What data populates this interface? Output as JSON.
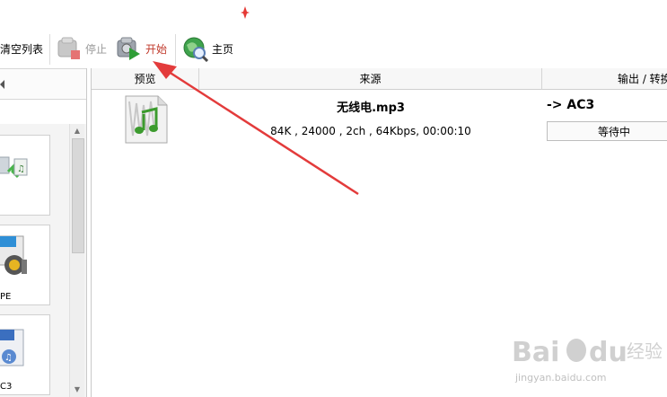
{
  "toolbar": {
    "clear_label": "清空列表",
    "stop_label": "停止",
    "start_label": "开始",
    "home_label": "主页"
  },
  "sidebar": {
    "cards": [
      {
        "label": ""
      },
      {
        "label": "PE"
      },
      {
        "label": "C3"
      }
    ]
  },
  "table": {
    "columns": [
      "预览",
      "来源",
      "输出 / 转换"
    ],
    "rows": [
      {
        "filename": "无线电.mp3",
        "info": "84K , 24000 , 2ch , 64Kbps, 00:00:10",
        "output_format": "-> AC3",
        "status": "等待中"
      }
    ]
  },
  "watermark": {
    "brand": "Bai du 经验",
    "url": "jingyan.baidu.com"
  },
  "colors": {
    "annotation": "#e33b3b",
    "start_label": "#c0392b"
  }
}
